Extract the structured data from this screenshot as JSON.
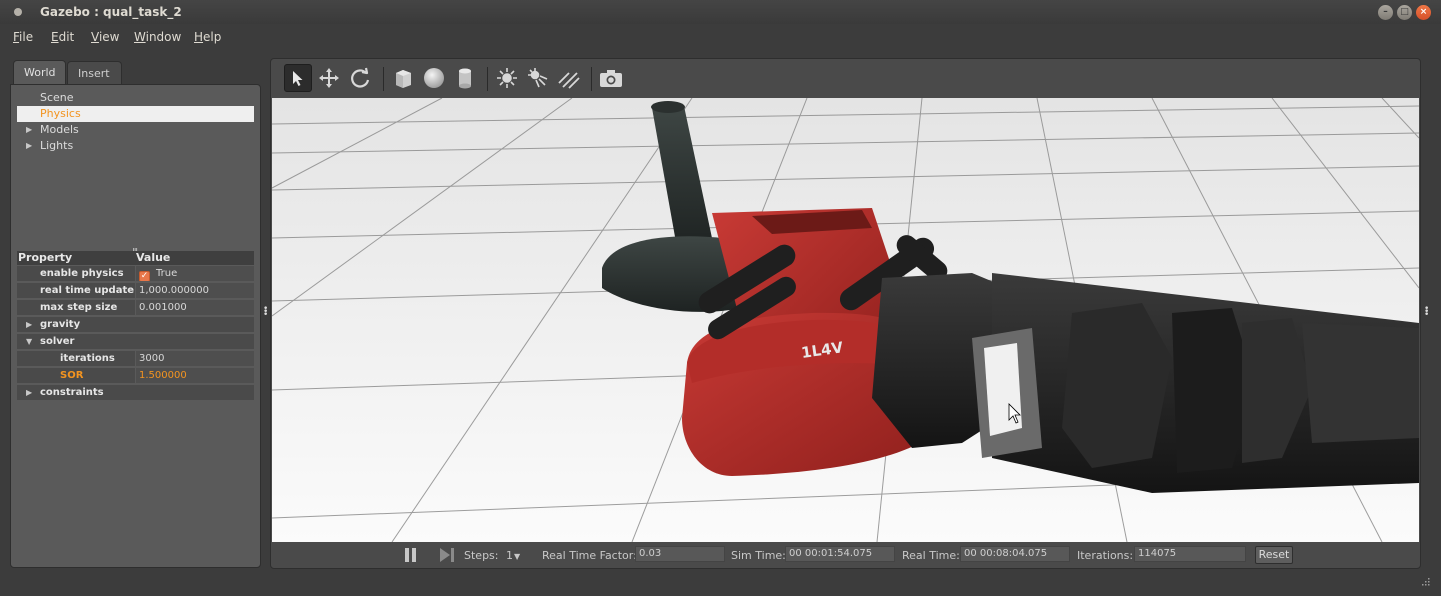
{
  "window": {
    "title": "Gazebo : qual_task_2",
    "controls": {
      "minimize": "–",
      "maximize": "□",
      "close": "×"
    }
  },
  "menu": [
    {
      "label": "File",
      "mnemonic": "F",
      "rest": "ile"
    },
    {
      "label": "Edit",
      "mnemonic": "E",
      "rest": "dit"
    },
    {
      "label": "View",
      "mnemonic": "V",
      "rest": "iew"
    },
    {
      "label": "Window",
      "mnemonic": "W",
      "rest": "indow"
    },
    {
      "label": "Help",
      "mnemonic": "H",
      "rest": "elp"
    }
  ],
  "left_panel": {
    "tabs": {
      "world": "World",
      "insert": "Insert"
    },
    "tree": {
      "scene": "Scene",
      "physics": "Physics",
      "models": "Models",
      "lights": "Lights"
    },
    "table_header": {
      "property": "Property",
      "value": "Value"
    },
    "properties": {
      "enable_physics": {
        "name": "enable physics",
        "value": "True"
      },
      "real_time_update": {
        "name": "real time update ...",
        "value": "1,000.000000"
      },
      "max_step_size": {
        "name": "max step size",
        "value": "0.001000"
      },
      "gravity": {
        "name": "gravity"
      },
      "solver": {
        "name": "solver"
      },
      "iterations": {
        "name": "iterations",
        "value": "3000"
      },
      "sor": {
        "name": "SOR",
        "value": "1.500000"
      },
      "constraints": {
        "name": "constraints"
      }
    }
  },
  "toolbar": {
    "tools": [
      "select-mode",
      "translate-mode",
      "rotate-mode",
      "box-shape",
      "sphere-shape",
      "cylinder-shape",
      "point-light",
      "spot-light",
      "directional-light",
      "screenshot"
    ]
  },
  "viewport": {
    "drill_label": "1L4V"
  },
  "status": {
    "steps_label": "Steps:",
    "steps_value": "1",
    "rtf_label": "Real Time Factor:",
    "rtf_value": "0.03",
    "sim_time_label": "Sim Time:",
    "sim_time_value": "00 00:01:54.075",
    "real_time_label": "Real Time:",
    "real_time_value": "00 00:08:04.075",
    "iterations_label": "Iterations:",
    "iterations_value": "114075",
    "reset_label": "Reset"
  },
  "colors": {
    "accent_orange": "#f39420",
    "panel_bg": "#5a5a5a",
    "window_bg": "#3c3c3c"
  }
}
